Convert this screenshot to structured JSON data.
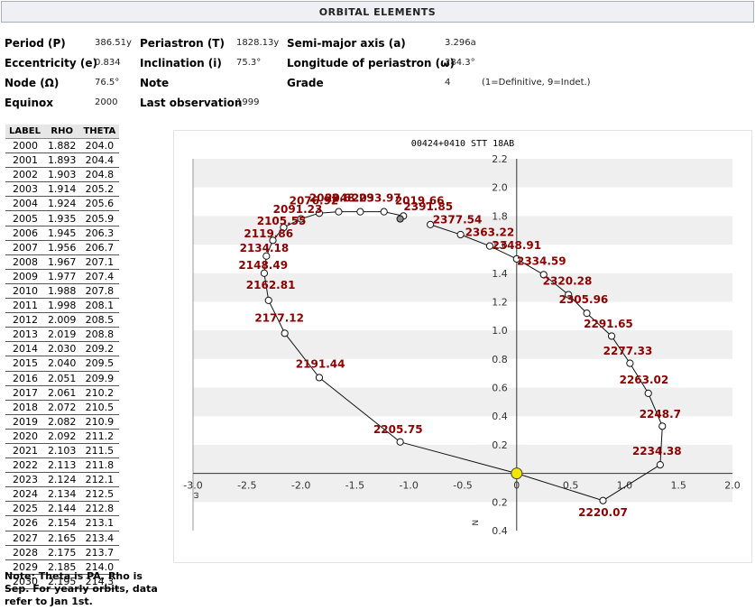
{
  "header": {
    "title": "ORBITAL ELEMENTS"
  },
  "elements": {
    "period_label": "Period (P)",
    "period_value": "386.51y",
    "periastron_label": "Periastron (T)",
    "periastron_value": "1828.13y",
    "semimajor_label": "Semi-major axis (a)",
    "semimajor_value": "3.296a",
    "ecc_label": "Eccentricity (e)",
    "ecc_value": "0.834",
    "incl_label": "Inclination (i)",
    "incl_value": "75.3°",
    "longperi_label": "Longitude of periastron (ω)",
    "longperi_value": "284.3°",
    "node_label": "Node (Ω)",
    "node_value": "76.5°",
    "note_label": "Note",
    "grade_label": "Grade",
    "grade_value": "4",
    "grade_hint": "(1=Definitive, 9=Indet.)",
    "equinox_label": "Equinox",
    "equinox_value": "2000",
    "lastobs_label": "Last observation",
    "lastobs_value": "1999"
  },
  "ephemeris": {
    "headers": [
      "LABEL",
      "RHO",
      "THETA"
    ],
    "rows": [
      [
        "2000",
        "1.882",
        "204.0"
      ],
      [
        "2001",
        "1.893",
        "204.4"
      ],
      [
        "2002",
        "1.903",
        "204.8"
      ],
      [
        "2003",
        "1.914",
        "205.2"
      ],
      [
        "2004",
        "1.924",
        "205.6"
      ],
      [
        "2005",
        "1.935",
        "205.9"
      ],
      [
        "2006",
        "1.945",
        "206.3"
      ],
      [
        "2007",
        "1.956",
        "206.7"
      ],
      [
        "2008",
        "1.967",
        "207.1"
      ],
      [
        "2009",
        "1.977",
        "207.4"
      ],
      [
        "2010",
        "1.988",
        "207.8"
      ],
      [
        "2011",
        "1.998",
        "208.1"
      ],
      [
        "2012",
        "2.009",
        "208.5"
      ],
      [
        "2013",
        "2.019",
        "208.8"
      ],
      [
        "2014",
        "2.030",
        "209.2"
      ],
      [
        "2015",
        "2.040",
        "209.5"
      ],
      [
        "2016",
        "2.051",
        "209.9"
      ],
      [
        "2017",
        "2.061",
        "210.2"
      ],
      [
        "2018",
        "2.072",
        "210.5"
      ],
      [
        "2019",
        "2.082",
        "210.9"
      ],
      [
        "2020",
        "2.092",
        "211.2"
      ],
      [
        "2021",
        "2.103",
        "211.5"
      ],
      [
        "2022",
        "2.113",
        "211.8"
      ],
      [
        "2023",
        "2.124",
        "212.1"
      ],
      [
        "2024",
        "2.134",
        "212.5"
      ],
      [
        "2025",
        "2.144",
        "212.8"
      ],
      [
        "2026",
        "2.154",
        "213.1"
      ],
      [
        "2027",
        "2.165",
        "213.4"
      ],
      [
        "2028",
        "2.175",
        "213.7"
      ],
      [
        "2029",
        "2.185",
        "214.0"
      ],
      [
        "2030",
        "2.195",
        "214.3"
      ]
    ]
  },
  "note": "Note: Theta is PA, Rho is Sep. For yearly orbits, data refer to Jan 1st.",
  "chart_data": {
    "type": "line",
    "title": "00424+0410  STT  18AB",
    "xlim": [
      -3.0,
      2.0
    ],
    "ylim": [
      -0.4,
      2.2
    ],
    "x_ticks": [
      -3.0,
      -2.5,
      -2.0,
      -1.5,
      -1.0,
      -0.5,
      0.0,
      0.5,
      1.0,
      1.5,
      2.0
    ],
    "x_tick_labels": [
      "-3.0",
      "-2.5",
      "-2.0",
      "-1.5",
      "-1.0",
      "-0.5",
      "0",
      "0.5",
      "1.0",
      "1.5",
      "2.0"
    ],
    "y_ticks": [
      -0.4,
      -0.2,
      0.2,
      0.4,
      0.6,
      0.8,
      1.0,
      1.2,
      1.4,
      1.6,
      1.8,
      2.0,
      2.2
    ],
    "y_tick_labels": [
      "0.4",
      "0.2",
      "0.2",
      "0.4",
      "0.6",
      "0.8",
      "1.0",
      "1.2",
      "1.4",
      "1.6",
      "1.8",
      "2.0",
      "2.2"
    ],
    "x_axis_letter": "ω",
    "y_axis_letter": "N",
    "grid": "horizontal alternating bands",
    "primary": {
      "x": 0.0,
      "y": 0.0,
      "color": "#f2e600"
    },
    "label_color": "#8b0000",
    "orbit": [
      {
        "x": -1.05,
        "y": 1.8
      },
      {
        "x": -1.23,
        "y": 1.83
      },
      {
        "x": -1.45,
        "y": 1.83
      },
      {
        "x": -1.65,
        "y": 1.83
      },
      {
        "x": -1.83,
        "y": 1.82
      },
      {
        "x": -2.0,
        "y": 1.78
      },
      {
        "x": -2.16,
        "y": 1.72
      },
      {
        "x": -2.26,
        "y": 1.63
      },
      {
        "x": -2.32,
        "y": 1.52
      },
      {
        "x": -2.34,
        "y": 1.4
      },
      {
        "x": -2.3,
        "y": 1.21
      },
      {
        "x": -2.15,
        "y": 0.98
      },
      {
        "x": -1.83,
        "y": 0.67
      },
      {
        "x": -1.08,
        "y": 0.22
      },
      {
        "x": 0.0,
        "y": 0.0
      },
      {
        "x": 0.8,
        "y": -0.19
      },
      {
        "x": 1.33,
        "y": 0.06
      },
      {
        "x": 1.35,
        "y": 0.33
      },
      {
        "x": 1.22,
        "y": 0.56
      },
      {
        "x": 1.05,
        "y": 0.77
      },
      {
        "x": 0.88,
        "y": 0.96
      },
      {
        "x": 0.65,
        "y": 1.12
      },
      {
        "x": 0.48,
        "y": 1.25
      },
      {
        "x": 0.25,
        "y": 1.39
      },
      {
        "x": 0.0,
        "y": 1.5
      },
      {
        "x": -0.25,
        "y": 1.59
      },
      {
        "x": -0.52,
        "y": 1.67
      },
      {
        "x": -0.8,
        "y": 1.74
      }
    ],
    "points": [
      {
        "x": -1.05,
        "y": 1.8,
        "marker": "open"
      },
      {
        "x": -1.23,
        "y": 1.83,
        "marker": "open"
      },
      {
        "x": -1.45,
        "y": 1.83,
        "marker": "open"
      },
      {
        "x": -1.65,
        "y": 1.83,
        "marker": "open"
      },
      {
        "x": -1.83,
        "y": 1.82,
        "marker": "open"
      },
      {
        "x": -2.0,
        "y": 1.78,
        "marker": "open"
      },
      {
        "x": -2.16,
        "y": 1.72,
        "marker": "open"
      },
      {
        "x": -2.26,
        "y": 1.63,
        "marker": "open"
      },
      {
        "x": -2.32,
        "y": 1.52,
        "marker": "open"
      },
      {
        "x": -2.34,
        "y": 1.4,
        "marker": "open"
      },
      {
        "x": -2.3,
        "y": 1.21,
        "marker": "open"
      },
      {
        "x": -2.15,
        "y": 0.98,
        "marker": "open"
      },
      {
        "x": -1.83,
        "y": 0.67,
        "marker": "open"
      },
      {
        "x": -1.08,
        "y": 0.22,
        "marker": "open"
      },
      {
        "x": 0.8,
        "y": -0.19,
        "marker": "open"
      },
      {
        "x": 1.33,
        "y": 0.06,
        "marker": "open"
      },
      {
        "x": 1.35,
        "y": 0.33,
        "marker": "open"
      },
      {
        "x": 1.22,
        "y": 0.56,
        "marker": "open"
      },
      {
        "x": 1.05,
        "y": 0.77,
        "marker": "open"
      },
      {
        "x": 0.88,
        "y": 0.96,
        "marker": "open"
      },
      {
        "x": 0.65,
        "y": 1.12,
        "marker": "open"
      },
      {
        "x": 0.48,
        "y": 1.25,
        "marker": "open"
      },
      {
        "x": 0.25,
        "y": 1.39,
        "marker": "open"
      },
      {
        "x": 0.0,
        "y": 1.5,
        "marker": "open"
      },
      {
        "x": -0.25,
        "y": 1.59,
        "marker": "open"
      },
      {
        "x": -0.52,
        "y": 1.67,
        "marker": "open"
      },
      {
        "x": -0.8,
        "y": 1.74,
        "marker": "open"
      },
      {
        "x": -1.08,
        "y": 1.78,
        "marker": "filled"
      }
    ],
    "labels": [
      {
        "text": "2019.66",
        "x": -0.9,
        "y": 1.88
      },
      {
        "text": "2033.97",
        "x": -1.3,
        "y": 1.9
      },
      {
        "text": "2048.29",
        "x": -1.55,
        "y": 1.9
      },
      {
        "text": "2062.6",
        "x": -1.73,
        "y": 1.9
      },
      {
        "text": "2076.92",
        "x": -1.88,
        "y": 1.88
      },
      {
        "text": "2091.23",
        "x": -2.03,
        "y": 1.82
      },
      {
        "text": "2105.55",
        "x": -2.18,
        "y": 1.74
      },
      {
        "text": "2119.86",
        "x": -2.3,
        "y": 1.65
      },
      {
        "text": "2134.18",
        "x": -2.34,
        "y": 1.55
      },
      {
        "text": "2148.49",
        "x": -2.35,
        "y": 1.43
      },
      {
        "text": "2162.81",
        "x": -2.28,
        "y": 1.29
      },
      {
        "text": "2177.12",
        "x": -2.2,
        "y": 1.06
      },
      {
        "text": "2191.44",
        "x": -1.82,
        "y": 0.74
      },
      {
        "text": "2205.75",
        "x": -1.1,
        "y": 0.28
      },
      {
        "text": "2220.07",
        "x": 0.8,
        "y": -0.3
      },
      {
        "text": "2234.38",
        "x": 1.3,
        "y": 0.13
      },
      {
        "text": "2248.7",
        "x": 1.33,
        "y": 0.39
      },
      {
        "text": "2263.02",
        "x": 1.18,
        "y": 0.63
      },
      {
        "text": "2277.33",
        "x": 1.03,
        "y": 0.83
      },
      {
        "text": "2291.65",
        "x": 0.85,
        "y": 1.02
      },
      {
        "text": "2305.96",
        "x": 0.62,
        "y": 1.19
      },
      {
        "text": "2320.28",
        "x": 0.47,
        "y": 1.32
      },
      {
        "text": "2334.59",
        "x": 0.23,
        "y": 1.46
      },
      {
        "text": "2348.91",
        "x": 0.0,
        "y": 1.57
      },
      {
        "text": "2363.22",
        "x": -0.25,
        "y": 1.66
      },
      {
        "text": "2377.54",
        "x": -0.55,
        "y": 1.75
      },
      {
        "text": "2391.85",
        "x": -0.82,
        "y": 1.84
      }
    ]
  }
}
